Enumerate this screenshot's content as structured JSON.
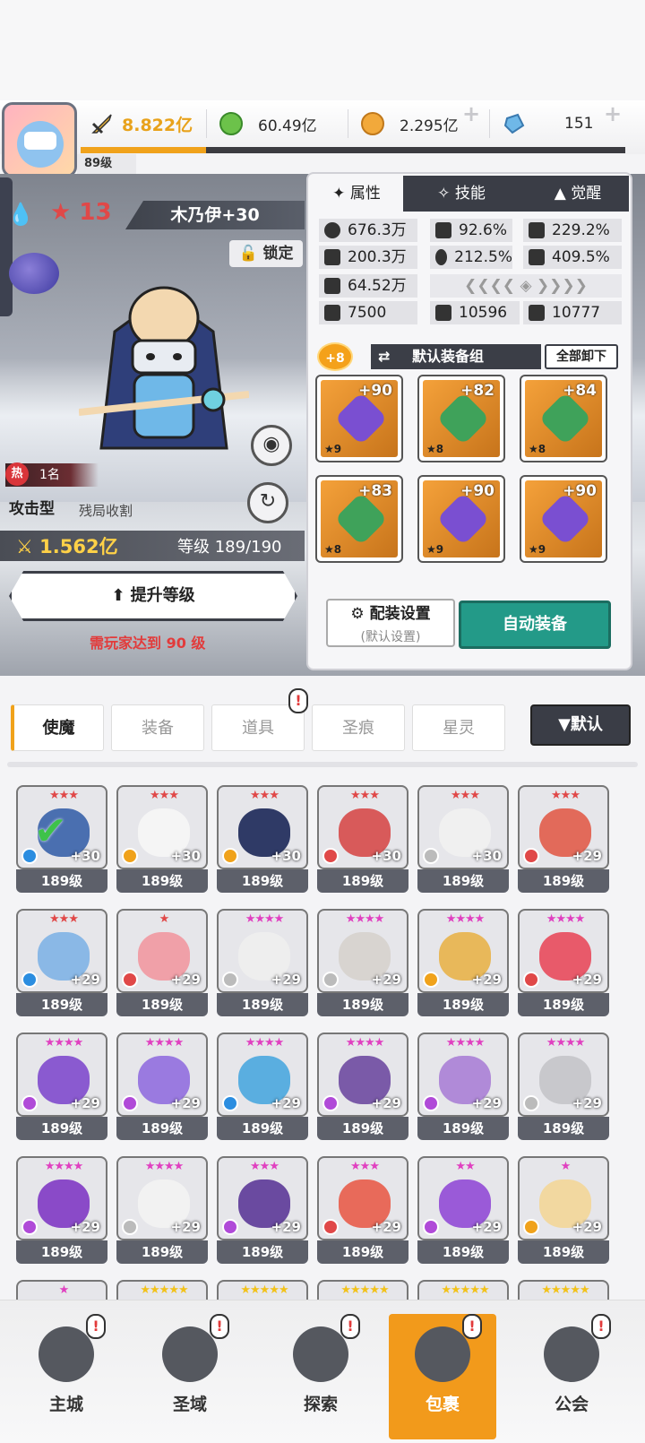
{
  "player": {
    "level": "89级",
    "power": "8.822亿",
    "xp_fraction": 0.23
  },
  "resources": [
    {
      "name": "green-orb",
      "value": "60.49亿",
      "color": "#6cc24a"
    },
    {
      "name": "gold-coin",
      "value": "2.295亿",
      "color": "#f2a93b"
    },
    {
      "name": "blue-crystal",
      "value": "151",
      "color": "#6fb8e8"
    }
  ],
  "hero": {
    "name": "木乃伊+30",
    "star": "13",
    "lock_label": "锁定",
    "hot_rank": "1名",
    "hot_label": "热",
    "role": "攻击型",
    "skill": "残局收割",
    "power": "1.562亿",
    "level_text": "等级 189/190",
    "upgrade_label": "提升等级",
    "requirement": "需玩家达到 90 级"
  },
  "attr_tabs": [
    "属性",
    "技能",
    "觉醒"
  ],
  "stats": {
    "hp": "676.3万",
    "crit": "92.6%",
    "crit_dmg": "229.2%",
    "atk": "200.3万",
    "hit": "212.5%",
    "speed": "409.5%",
    "def": "64.52万",
    "s1": "7500",
    "s2": "10596",
    "s3": "10777"
  },
  "equip": {
    "plus": "+8",
    "group_label": "默认装备组",
    "unequip_label": "全部卸下",
    "slots": [
      {
        "lv": "+90",
        "star": "★9",
        "color": "#7a4fd1"
      },
      {
        "lv": "+82",
        "star": "★8",
        "color": "#3fa25a"
      },
      {
        "lv": "+84",
        "star": "★8",
        "color": "#3fa25a"
      },
      {
        "lv": "+83",
        "star": "★8",
        "color": "#3fa25a"
      },
      {
        "lv": "+90",
        "star": "★9",
        "color": "#7a4fd1"
      },
      {
        "lv": "+90",
        "star": "★9",
        "color": "#7a4fd1"
      }
    ],
    "config_label": "配装设置",
    "config_sub": "(默认设置)",
    "auto_label": "自动装备"
  },
  "categories": [
    "使魔",
    "装备",
    "道具",
    "圣痕",
    "星灵"
  ],
  "sort_label": "▼默认",
  "cards": [
    {
      "stars": "★★★",
      "plv": "+30",
      "lv": "189级",
      "color": "#4a6fb0",
      "elem": "#2b8de0",
      "star_color": "#e04848"
    },
    {
      "stars": "★★★",
      "plv": "+30",
      "lv": "189级",
      "color": "#f5f5f5",
      "elem": "#f0a21b",
      "star_color": "#e04848"
    },
    {
      "stars": "★★★",
      "plv": "+30",
      "lv": "189级",
      "color": "#2f3a66",
      "elem": "#f0a21b",
      "star_color": "#e04848"
    },
    {
      "stars": "★★★",
      "plv": "+30",
      "lv": "189级",
      "color": "#d85a5a",
      "elem": "#e04848",
      "star_color": "#e04848"
    },
    {
      "stars": "★★★",
      "plv": "+30",
      "lv": "189级",
      "color": "#f0f0f0",
      "elem": "#bbbbbb",
      "star_color": "#e04848"
    },
    {
      "stars": "★★★",
      "plv": "+29",
      "lv": "189级",
      "color": "#e26a5a",
      "elem": "#e04848",
      "star_color": "#e04848"
    },
    {
      "stars": "★★★",
      "plv": "+29",
      "lv": "189级",
      "color": "#8ab8e6",
      "elem": "#2b8de0",
      "star_color": "#e04848"
    },
    {
      "stars": "★",
      "plv": "+29",
      "lv": "189级",
      "color": "#f0a0a8",
      "elem": "#e04848",
      "star_color": "#e04848"
    },
    {
      "stars": "★★★★",
      "plv": "+29",
      "lv": "189级",
      "color": "#eeeeee",
      "elem": "#bbbbbb",
      "star_color": "#e040c0"
    },
    {
      "stars": "★★★★",
      "plv": "+29",
      "lv": "189级",
      "color": "#d8d4d0",
      "elem": "#bbbbbb",
      "star_color": "#e040c0"
    },
    {
      "stars": "★★★★",
      "plv": "+29",
      "lv": "189级",
      "color": "#e8b85a",
      "elem": "#f0a21b",
      "star_color": "#e040c0"
    },
    {
      "stars": "★★★★",
      "plv": "+29",
      "lv": "189级",
      "color": "#e85a6a",
      "elem": "#e04848",
      "star_color": "#e040c0"
    },
    {
      "stars": "★★★★",
      "plv": "+29",
      "lv": "189级",
      "color": "#8a5ad0",
      "elem": "#b04ad8",
      "star_color": "#e040c0"
    },
    {
      "stars": "★★★★",
      "plv": "+29",
      "lv": "189级",
      "color": "#9a7ae0",
      "elem": "#b04ad8",
      "star_color": "#e040c0"
    },
    {
      "stars": "★★★★",
      "plv": "+29",
      "lv": "189级",
      "color": "#5aaee0",
      "elem": "#2b8de0",
      "star_color": "#e040c0"
    },
    {
      "stars": "★★★★",
      "plv": "+29",
      "lv": "189级",
      "color": "#7a5aa8",
      "elem": "#b04ad8",
      "star_color": "#e040c0"
    },
    {
      "stars": "★★★★",
      "plv": "+29",
      "lv": "189级",
      "color": "#b08ad8",
      "elem": "#b04ad8",
      "star_color": "#e040c0"
    },
    {
      "stars": "★★★★",
      "plv": "+29",
      "lv": "189级",
      "color": "#c8c8cc",
      "elem": "#bbbbbb",
      "star_color": "#e040c0"
    },
    {
      "stars": "★★★★",
      "plv": "+29",
      "lv": "189级",
      "color": "#8a4ac8",
      "elem": "#b04ad8",
      "star_color": "#e040c0"
    },
    {
      "stars": "★★★★",
      "plv": "+29",
      "lv": "189级",
      "color": "#f2f2f2",
      "elem": "#bbbbbb",
      "star_color": "#e040c0"
    },
    {
      "stars": "★★★",
      "plv": "+29",
      "lv": "189级",
      "color": "#6a4aa0",
      "elem": "#b04ad8",
      "star_color": "#e040c0"
    },
    {
      "stars": "★★★",
      "plv": "+29",
      "lv": "189级",
      "color": "#e86a5a",
      "elem": "#e04848",
      "star_color": "#e040c0"
    },
    {
      "stars": "★★",
      "plv": "+29",
      "lv": "189级",
      "color": "#9a5ad8",
      "elem": "#b04ad8",
      "star_color": "#e040c0"
    },
    {
      "stars": "★",
      "plv": "+29",
      "lv": "189级",
      "color": "#f2d8a0",
      "elem": "#f0a21b",
      "star_color": "#e040c0"
    },
    {
      "stars": "★",
      "plv": "",
      "lv": "",
      "color": "#e8e0d8",
      "elem": "",
      "star_color": "#e040c0"
    },
    {
      "stars": "★★★★★",
      "plv": "",
      "lv": "",
      "color": "#c8c0d8",
      "elem": "",
      "star_color": "#f2c21b"
    },
    {
      "stars": "★★★★★",
      "plv": "",
      "lv": "",
      "color": "#b89ae0",
      "elem": "",
      "star_color": "#f2c21b"
    },
    {
      "stars": "★★★★★",
      "plv": "",
      "lv": "",
      "color": "#6a88c8",
      "elem": "",
      "star_color": "#f2c21b"
    },
    {
      "stars": "★★★★★",
      "plv": "",
      "lv": "",
      "color": "#6a4aa8",
      "elem": "",
      "star_color": "#f2c21b"
    },
    {
      "stars": "★★★★★",
      "plv": "",
      "lv": "",
      "color": "#8a8ea0",
      "elem": "",
      "star_color": "#f2c21b"
    }
  ],
  "nav": [
    {
      "label": "主城",
      "icon": "castle-icon"
    },
    {
      "label": "圣域",
      "icon": "vortex-icon"
    },
    {
      "label": "探索",
      "icon": "sword-icon"
    },
    {
      "label": "包裹",
      "icon": "bag-icon"
    },
    {
      "label": "公会",
      "icon": "guild-icon"
    }
  ]
}
